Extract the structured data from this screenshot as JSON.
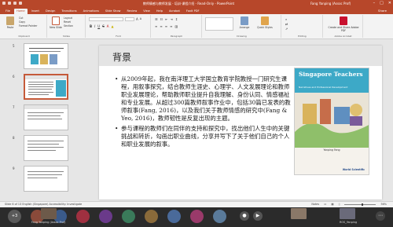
{
  "window": {
    "title": "教师情感与教师发展 - 培训-课程介绍 - Read-Only - PowerPoint",
    "user": "Fang Yanping (Assoc Prof)",
    "share_label": "Share"
  },
  "tabs": [
    "File",
    "Home",
    "Insert",
    "Design",
    "Transitions",
    "Animations",
    "Slide Show",
    "Review",
    "View",
    "Help",
    "Acrobat",
    "Foxit PDF"
  ],
  "ribbon": {
    "clipboard": {
      "paste": "Paste",
      "cut": "Cut",
      "copy": "Copy",
      "format_painter": "Format Painter",
      "label": "Clipboard"
    },
    "slides": {
      "new_slide": "New Slide",
      "layout": "Layout",
      "reset": "Reset",
      "section": "Section",
      "label": "Slides"
    },
    "font": {
      "label": "Font"
    },
    "paragraph": {
      "label": "Paragraph"
    },
    "drawing": {
      "arrange": "Arrange",
      "quick_styles": "Quick Styles",
      "label": "Drawing"
    },
    "editing": {
      "label": "Editing"
    },
    "pdf": {
      "create_share": "Create and Share Adobe PDF",
      "label": "Adobe Acrobat"
    }
  },
  "thumbnails": [
    {
      "num": "5",
      "selected": false
    },
    {
      "num": "6",
      "selected": true
    },
    {
      "num": "7",
      "selected": false
    },
    {
      "num": "8",
      "selected": false
    },
    {
      "num": "9",
      "selected": false
    }
  ],
  "slide": {
    "title": "背景",
    "bullet1": "从2009年起，我在南洋理工大学国立教育学院教授一门研究生课程，用叙事探究，结合教师生涯史、心理学、人文发展理论和教师职业发展理论，帮助教师职业提升自我理解、身份认同、情感福祉和专业发展。从超过300篇教师叙事作业中，包括30篇已发表的教师叙事(Fang, 2016)，以及我们关于教师情感的研究中(Fang & Yeo, 2016)，教师韧性是反复出现的主题。",
    "bullet2": "参与课程的教师们在同伴的支持和探究中，找出他们人生中的关键挑战和转折，勾画出职业曲线，分享并写下了关于他们自己的个人和职业发展的叙事。",
    "book": {
      "title": "Singapore Teachers",
      "subtitle": "Narratives and Professional Development",
      "editor": "Yanping Fang",
      "publisher": "World Scientific"
    }
  },
  "status": {
    "left": "Slide 6 of 13   English (Singapore)   Accessibility: Investigate",
    "notes": "Notes",
    "zoom": "56%"
  },
  "meeting": {
    "participants": [
      {
        "initials": "+3",
        "color": "#5a5a5a"
      },
      {
        "initials": "",
        "color": "#8a4a3a"
      },
      {
        "initials": "",
        "color": "#3a5a8a"
      },
      {
        "initials": "",
        "color": "#a03040"
      },
      {
        "initials": "",
        "color": "#6a3a8a"
      },
      {
        "initials": "",
        "color": "#3a7a5a"
      },
      {
        "initials": "",
        "color": "#8a6a3a"
      },
      {
        "initials": "",
        "color": "#4a6a9a"
      },
      {
        "initials": "",
        "color": "#9a3a6a"
      },
      {
        "initials": "",
        "color": "#5a7a9a"
      }
    ],
    "tile_left_label": "Fang Yanping (Assoc Prof)",
    "tile_right_label": "ROS_Yanping"
  }
}
